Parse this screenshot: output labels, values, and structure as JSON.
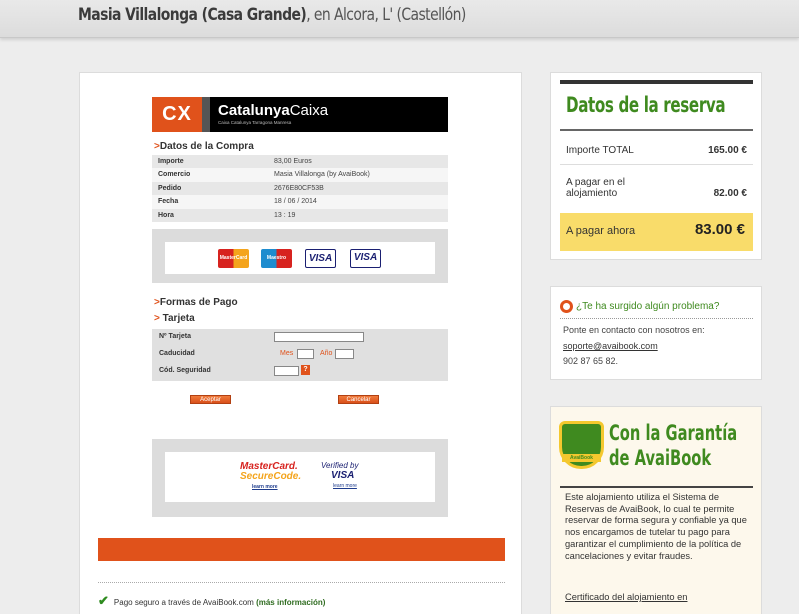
{
  "header": {
    "hotel_name": "Masia Villalonga (Casa Grande)",
    "location": ", en Alcora, L' (Castellón)"
  },
  "bank": {
    "logo_letters": "CX",
    "name_a": "Catalunya",
    "name_b": "Caixa",
    "subtitle": "Caixa Catalunya Tarragona Manresa"
  },
  "purchase": {
    "title": "Datos de la Compra",
    "rows": [
      {
        "label": "Importe",
        "value": "83,00   Euros"
      },
      {
        "label": "Comercio",
        "value": "Masia Villalonga (by AvaiBook)"
      },
      {
        "label": "Pedido",
        "value": "2676E80CF53B"
      },
      {
        "label": "Fecha",
        "value": "18 / 06 / 2014"
      },
      {
        "label": "Hora",
        "value": "13 : 19"
      }
    ]
  },
  "card_logos": {
    "mastercard": "MasterCard",
    "maestro": "Maestro",
    "visa": "VISA",
    "visa_electron": "VISA"
  },
  "payment": {
    "formas_title": "Formas de Pago",
    "tarjeta_title": "Tarjeta",
    "card_number_label": "Nº Tarjeta",
    "expiry_label": "Caducidad",
    "month_label": "Mes",
    "year_label": "Año",
    "cvv_label": "Cód. Seguridad",
    "help": "?",
    "accept_label": "Aceptar",
    "cancel_label": "Cancelar"
  },
  "secure_logos": {
    "mc_a": "MasterCard.",
    "mc_b": "SecureCode.",
    "mc_learn": "learn more",
    "vbv_a": "Verified by",
    "vbv_b": "VISA",
    "vbv_learn": "learn more"
  },
  "footer": {
    "secure_text": "Pago seguro a través de AvaiBook.com",
    "more_info": "(más información)"
  },
  "reservation": {
    "title": "Datos de la reserva",
    "total_label": "Importe TOTAL",
    "total_value": "165.00 €",
    "at_lodging_label_1": "A pagar en el",
    "at_lodging_label_2": "alojamiento",
    "at_lodging_value": "82.00 €",
    "now_label": "A pagar ahora",
    "now_value": "83.00 €"
  },
  "problem": {
    "title": "¿Te ha surgido algún problema?",
    "text": "Ponte en contacto con nosotros en:",
    "email": "soporte@avaibook.com",
    "phone": "902 87 65 82."
  },
  "guarantee": {
    "badge": "AvaiBook",
    "title_1": "Con la Garantía",
    "title_2": "de AvaiBook",
    "text": "Este alojamiento utiliza el Sistema de Reservas de AvaiBook, lo cual te permite reservar de forma segura y confiable ya que nos encargamos de tutelar tu pago para garantizar el cumplimiento de la política de cancelaciones y evitar fraudes.",
    "link": "Certificado del alojamiento en"
  }
}
